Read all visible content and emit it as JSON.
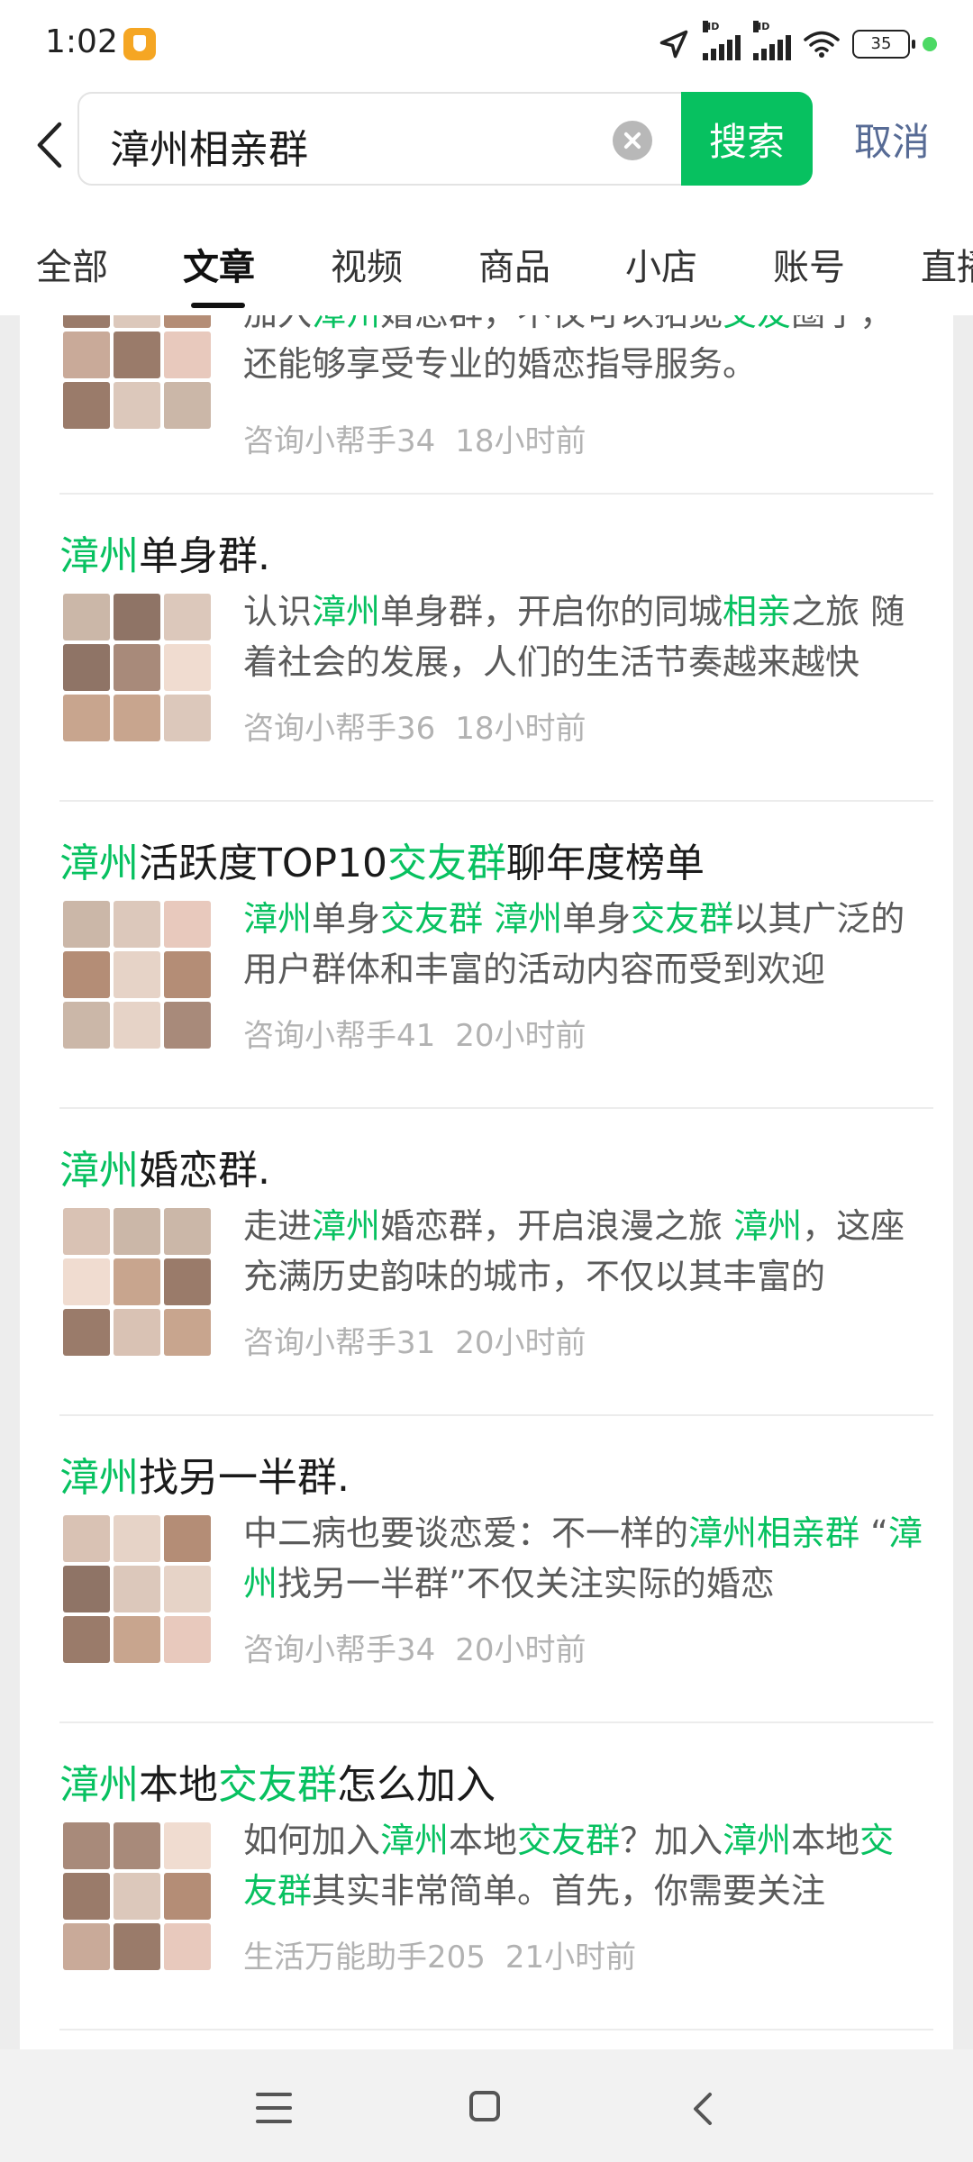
{
  "status_bar": {
    "time": "1:02",
    "battery": "35",
    "icons": [
      "app-badge-icon",
      "location-icon",
      "signal-hd-icon",
      "signal-hd-icon",
      "wifi-icon",
      "battery-icon",
      "green-dot-icon"
    ]
  },
  "search": {
    "query": "漳州相亲群",
    "button_label": "搜索",
    "cancel_label": "取消"
  },
  "tabs": [
    {
      "label": "全部"
    },
    {
      "label": "文章"
    },
    {
      "label": "视频"
    },
    {
      "label": "商品"
    },
    {
      "label": "小店"
    },
    {
      "label": "账号"
    },
    {
      "label": "直播"
    }
  ],
  "active_tab": "文章",
  "results": [
    {
      "desc": "加入漳州婚恋群，不仅可以拓宽交友圈子，还能够享受专业的婚恋指导服务。",
      "author": "咨询小帮手34",
      "time": "18小时前"
    },
    {
      "title": "漳州单身群.",
      "desc": "认识漳州单身群，开启你的同城相亲之旅 随着社会的发展，人们的生活节奏越来越快",
      "author": "咨询小帮手36",
      "time": "18小时前"
    },
    {
      "title": "漳州活跃度TOP10交友群聊年度榜单",
      "desc": "漳州单身交友群 漳州单身交友群以其广泛的用户群体和丰富的活动内容而受到欢迎",
      "author": "咨询小帮手41",
      "time": "20小时前"
    },
    {
      "title": "漳州婚恋群.",
      "desc": "走进漳州婚恋群，开启浪漫之旅 漳州，这座充满历史韵味的城市，不仅以其丰富的",
      "author": "咨询小帮手31",
      "time": "20小时前"
    },
    {
      "title": "漳州找另一半群.",
      "desc": "中二病也要谈恋爱：不一样的漳州相亲群 “漳州找另一半群”不仅关注实际的婚恋",
      "author": "咨询小帮手34",
      "time": "20小时前"
    },
    {
      "title": "漳州本地交友群怎么加入",
      "desc": "如何加入漳州本地交友群？加入漳州本地交友群其实非常简单。首先，你需要关注",
      "author": "生活万能助手205",
      "time": "21小时前"
    }
  ],
  "highlight_terms": [
    "漳州",
    "相亲群",
    "相亲",
    "交友群",
    "交友"
  ],
  "colors": {
    "accent_green": "#07c160",
    "link_blue": "#576b95",
    "page_bg": "#ededed"
  },
  "nav_icons": [
    "menu-icon",
    "home-icon",
    "back-icon"
  ]
}
